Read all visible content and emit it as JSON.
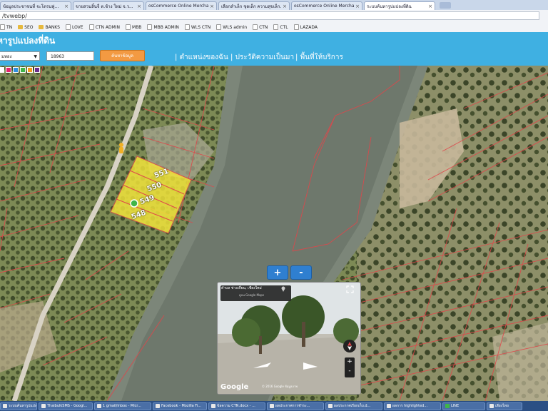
{
  "browser": {
    "tabs": [
      {
        "label": "ข้อมูลประชาชนที่ จะโตรนฟู...",
        "active": false
      },
      {
        "label": "ขายสวนลิ้นจี่ ต.ช้าง ใหม่ จ.ว...",
        "active": false
      },
      {
        "label": "osCommerce Online Merchant",
        "active": false
      },
      {
        "label": "เลือกลำเล็ก ชุดเล็ก ความสุขเล็ก...",
        "active": false
      },
      {
        "label": "osCommerce Online Merchant",
        "active": false
      },
      {
        "label": "ระบบค้นหารูปแปลงที่ดิน",
        "active": true
      }
    ],
    "url": "/tvwebp/",
    "bookmarks": [
      {
        "label": "TN",
        "icon": "page-icon"
      },
      {
        "label": "SEO",
        "icon": "folder-icon"
      },
      {
        "label": "BANKS",
        "icon": "folder-icon"
      },
      {
        "label": "LOVE",
        "icon": "page-icon"
      },
      {
        "label": "CTN ADMIN",
        "icon": "page-icon"
      },
      {
        "label": "MBB",
        "icon": "page-icon"
      },
      {
        "label": "MBB ADMIN",
        "icon": "page-icon"
      },
      {
        "label": "WLS CTN",
        "icon": "page-icon"
      },
      {
        "label": "WLS admin",
        "icon": "page-icon"
      },
      {
        "label": "CTN",
        "icon": "page-icon"
      },
      {
        "label": "CTL",
        "icon": "page-icon"
      },
      {
        "label": "LAZADA",
        "icon": "page-icon"
      }
    ]
  },
  "app": {
    "title": "หารูปแปลงที่ดิน",
    "province_select": "มทอง",
    "parcel_number": "18963",
    "search_button": "ค้นหาข้อมูล",
    "nav": [
      "ตำแหน่งของฉัน",
      "ประวัติความเป็นมา",
      "พื้นที่ให้บริการ"
    ],
    "palette_colors": [
      "#ffffff",
      "#e6236b",
      "#2f8fe0",
      "#3fb548",
      "#f39a1e",
      "#6b2d8c"
    ]
  },
  "map": {
    "parcels": [
      "551",
      "550",
      "549",
      "548"
    ],
    "zoom_in": "+",
    "zoom_out": "-",
    "accent": "#3fb0e2",
    "highlight_color": "#f4e63a"
  },
  "streetview": {
    "title": "ตำบล ช่างเคี่ยน, เชียงใหม่",
    "subtitle": "ดูบน Google Maps",
    "logo": "Google",
    "copyright": "© 2016 Google  ข้อมูลภาพ",
    "zoom_plus": "+",
    "zoom_minus": "-"
  },
  "taskbar": [
    {
      "label": "ระบบค้นหารูปแปลงที่..."
    },
    {
      "label": "ThaibulkSMS - Googl..."
    },
    {
      "label": "1 gmail/inbox - Micr..."
    },
    {
      "label": "Facebook - Mozilla Fi..."
    },
    {
      "label": "ข้อความ CTN.docx - ..."
    },
    {
      "label": "ผลประกาศการชำระ..."
    },
    {
      "label": "ผลประกาศเรียกเก็บ.d..."
    },
    {
      "label": "ผลการ highlighted..."
    },
    {
      "label": "LINE"
    },
    {
      "label": "เสียงไทย"
    }
  ]
}
